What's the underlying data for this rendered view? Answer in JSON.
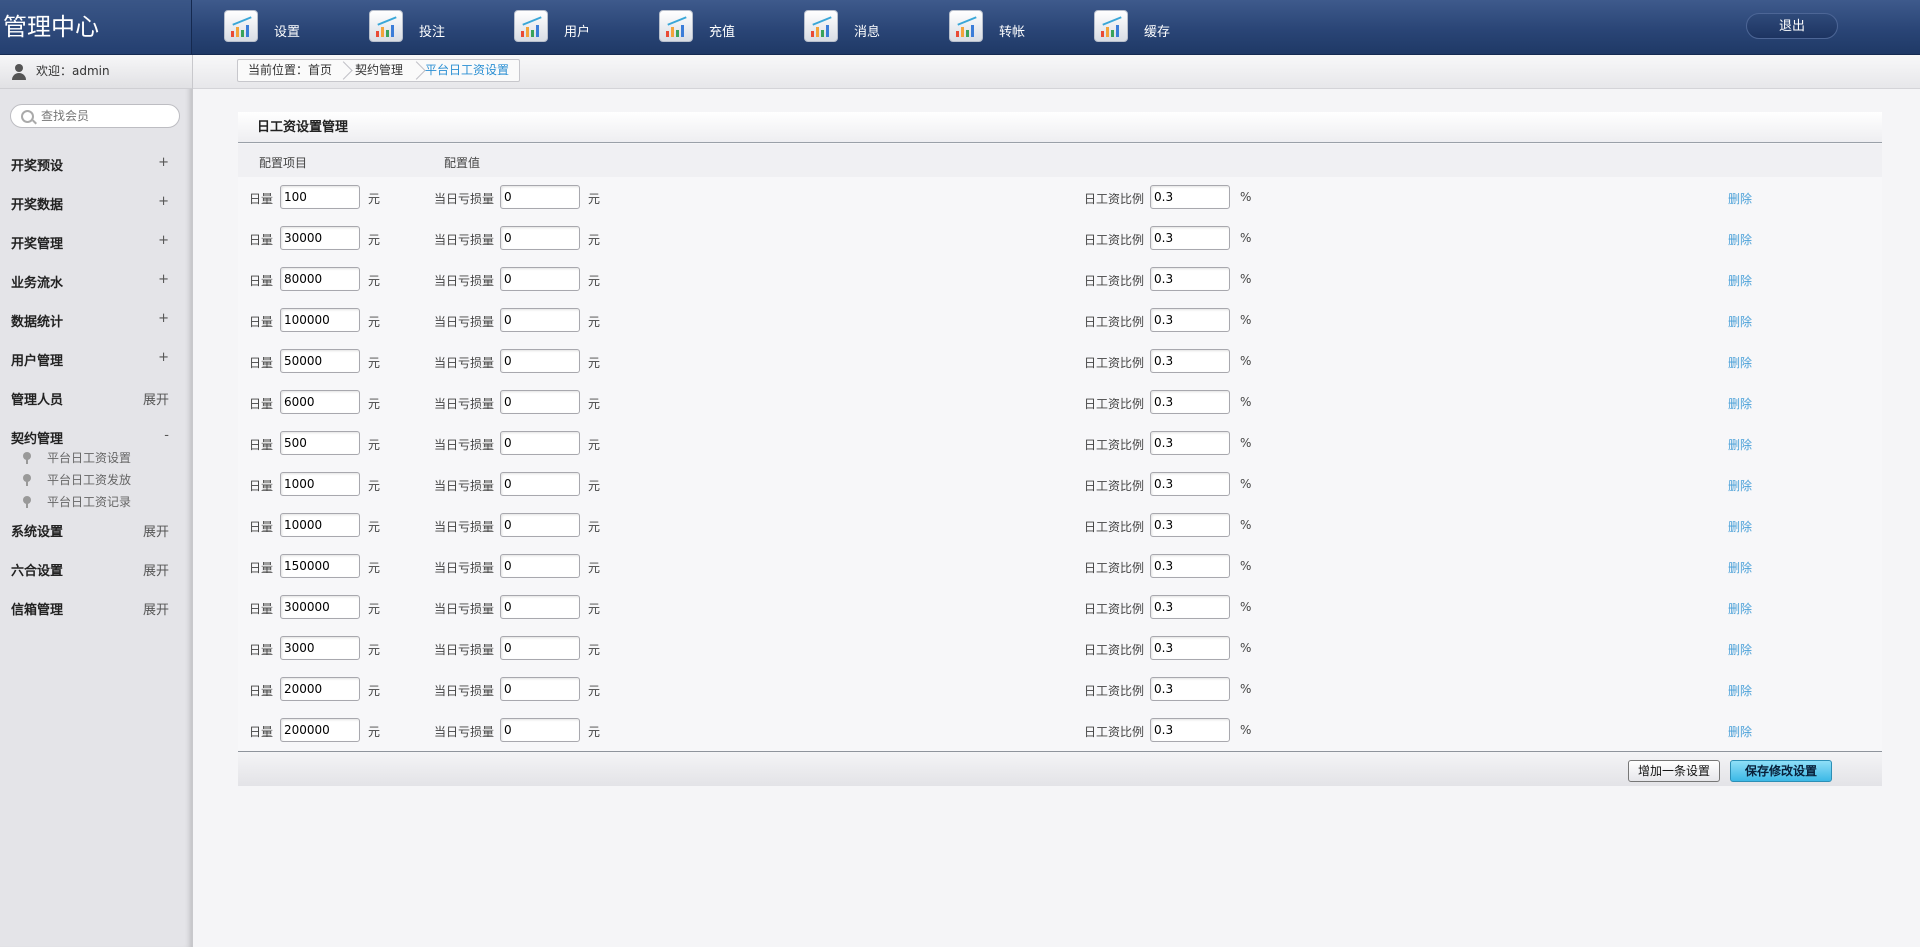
{
  "app": {
    "title": "管理中心"
  },
  "topnav": [
    {
      "label": "设置"
    },
    {
      "label": "投注"
    },
    {
      "label": "用户"
    },
    {
      "label": "充值"
    },
    {
      "label": "消息"
    },
    {
      "label": "转帐"
    },
    {
      "label": "缓存"
    }
  ],
  "logout_label": "退出",
  "sidebar": {
    "welcome": "欢迎：admin",
    "search_placeholder": "查找会员",
    "menu_top": [
      {
        "label": "开奖预设",
        "toggle": "+"
      },
      {
        "label": "开奖数据",
        "toggle": "+"
      },
      {
        "label": "开奖管理",
        "toggle": "+"
      },
      {
        "label": "业务流水",
        "toggle": "+"
      },
      {
        "label": "数据统计",
        "toggle": "+"
      },
      {
        "label": "用户管理",
        "toggle": "+"
      },
      {
        "label": "管理人员",
        "toggle": "展开"
      },
      {
        "label": "契约管理",
        "toggle": "-"
      }
    ],
    "submenu": [
      {
        "label": "平台日工资设置"
      },
      {
        "label": "平台日工资发放"
      },
      {
        "label": "平台日工资记录"
      }
    ],
    "menu_bottom": [
      {
        "label": "系统设置",
        "toggle": "展开"
      },
      {
        "label": "六合设置",
        "toggle": "展开"
      },
      {
        "label": "信箱管理",
        "toggle": "展开"
      }
    ]
  },
  "breadcrumb": {
    "prefix": "当前位置：首页",
    "middle": "契约管理",
    "current": "平台日工资设置"
  },
  "panel": {
    "title": "日工资设置管理",
    "col_item": "配置项目",
    "col_value": "配置值",
    "label_daily": "日量",
    "label_loss": "当日亏损量",
    "label_ratio": "日工资比例",
    "unit_yuan": "元",
    "unit_percent": "%",
    "delete_label": "删除",
    "rows": [
      {
        "daily": "100",
        "loss": "0",
        "ratio": "0.3"
      },
      {
        "daily": "30000",
        "loss": "0",
        "ratio": "0.3"
      },
      {
        "daily": "80000",
        "loss": "0",
        "ratio": "0.3"
      },
      {
        "daily": "100000",
        "loss": "0",
        "ratio": "0.3"
      },
      {
        "daily": "50000",
        "loss": "0",
        "ratio": "0.3"
      },
      {
        "daily": "6000",
        "loss": "0",
        "ratio": "0.3"
      },
      {
        "daily": "500",
        "loss": "0",
        "ratio": "0.3"
      },
      {
        "daily": "1000",
        "loss": "0",
        "ratio": "0.3"
      },
      {
        "daily": "10000",
        "loss": "0",
        "ratio": "0.3"
      },
      {
        "daily": "150000",
        "loss": "0",
        "ratio": "0.3"
      },
      {
        "daily": "300000",
        "loss": "0",
        "ratio": "0.3"
      },
      {
        "daily": "3000",
        "loss": "0",
        "ratio": "0.3"
      },
      {
        "daily": "20000",
        "loss": "0",
        "ratio": "0.3"
      },
      {
        "daily": "200000",
        "loss": "0",
        "ratio": "0.3"
      }
    ],
    "add_button": "增加一条设置",
    "save_button": "保存修改设置"
  }
}
